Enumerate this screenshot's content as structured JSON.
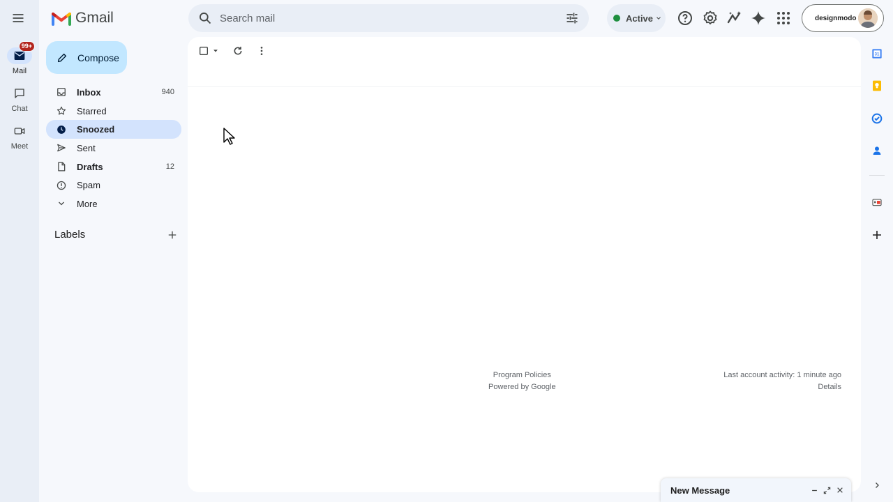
{
  "rail": {
    "items": [
      {
        "label": "Mail",
        "badge": "99+"
      },
      {
        "label": "Chat"
      },
      {
        "label": "Meet"
      }
    ]
  },
  "header": {
    "logo_text": "Gmail",
    "search_placeholder": "Search mail",
    "status_label": "Active",
    "status_color": "#1e8e3e",
    "account_name": "designmodo"
  },
  "compose": {
    "label": "Compose"
  },
  "nav": {
    "items": [
      {
        "label": "Inbox",
        "count": "940",
        "icon": "inbox-icon",
        "bold": true
      },
      {
        "label": "Starred",
        "count": "",
        "icon": "star-icon"
      },
      {
        "label": "Snoozed",
        "count": "",
        "icon": "clock-icon",
        "bold": true,
        "active": true
      },
      {
        "label": "Sent",
        "count": "",
        "icon": "send-icon"
      },
      {
        "label": "Drafts",
        "count": "12",
        "icon": "draft-icon",
        "bold": true
      },
      {
        "label": "Spam",
        "count": "",
        "icon": "spam-icon"
      },
      {
        "label": "More",
        "count": "",
        "icon": "chevron-down-icon"
      }
    ]
  },
  "labels": {
    "title": "Labels"
  },
  "footer": {
    "program_policies": "Program Policies",
    "powered_by": "Powered by Google",
    "last_activity": "Last account activity: 1 minute ago",
    "details": "Details"
  },
  "new_message": {
    "title": "New Message"
  },
  "colors": {
    "accent": "#0b57d0",
    "compose_bg": "#c2e7ff",
    "active_nav_bg": "#d3e3fd",
    "badge": "#b3261e"
  }
}
